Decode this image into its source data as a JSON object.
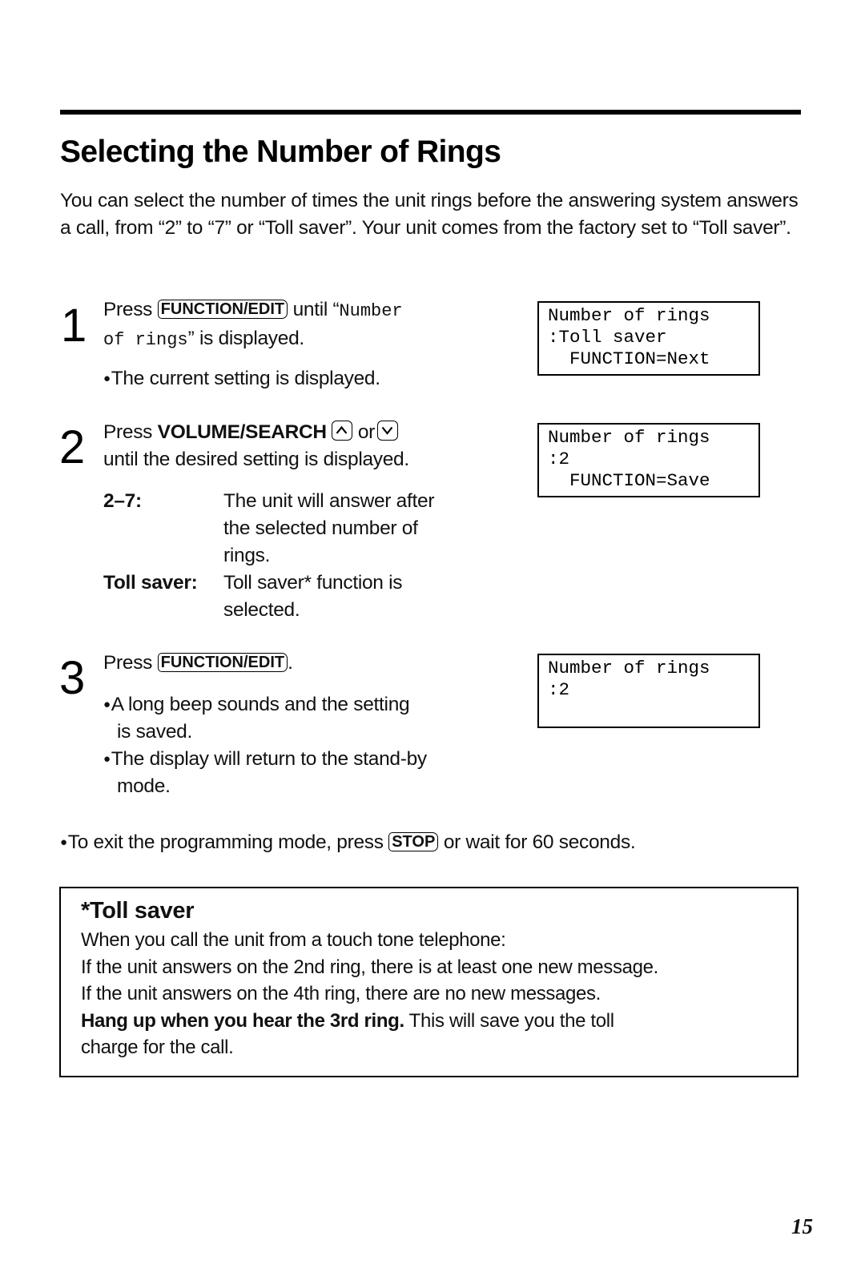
{
  "page": {
    "title": "Selecting the Number of Rings",
    "intro": "You can select the number of times the unit rings before the answering system answers a call, from “2” to “7” or “Toll saver”. Your unit comes from the factory set to “Toll saver”.",
    "page_number": "15"
  },
  "steps": [
    {
      "number": "1",
      "press": "Press",
      "key": "FUNCTION/EDIT",
      "until": "until “",
      "display_name_a": "Number",
      "display_name_b": "of rings",
      "after": "” is displayed.",
      "bullet": "The current setting is displayed.",
      "lcd": [
        "Number of rings",
        ":Toll saver",
        "  FUNCTION=Next"
      ]
    },
    {
      "number": "2",
      "press": "Press",
      "key_label": "VOLUME/SEARCH",
      "up_icon": "chevron-up-icon",
      "or": "or",
      "down_icon": "chevron-down-icon",
      "line2": "until the desired setting is displayed.",
      "definitions": [
        {
          "term": "2–7:",
          "desc_lines": [
            "The unit will answer after",
            "the selected number of",
            "rings."
          ]
        },
        {
          "term": "Toll saver:",
          "desc_lines": [
            "Toll saver* function is",
            "selected."
          ]
        }
      ],
      "lcd": [
        "Number of rings",
        ":2",
        "  FUNCTION=Save"
      ]
    },
    {
      "number": "3",
      "press": "Press",
      "key": "FUNCTION/EDIT",
      "period": ".",
      "bullets": [
        [
          "A long beep sounds and the setting",
          "is saved."
        ],
        [
          "The display will return to the stand-by",
          "mode."
        ]
      ],
      "lcd": [
        "Number of rings",
        ":2",
        ""
      ]
    }
  ],
  "exit_note": {
    "before": "To exit the programming mode, press",
    "key": "STOP",
    "after": "or wait for 60 seconds."
  },
  "toll_saver_box": {
    "title": "*Toll saver",
    "lines": [
      "When you call the unit from a touch tone telephone:",
      "If the unit answers on the 2nd ring, there is at least one new message.",
      "If the unit answers on the 4th ring, there are no new messages."
    ],
    "bold_part": "Hang up when you hear the 3rd ring.",
    "rest_part": " This will save you the toll",
    "last_line": "charge for the call."
  }
}
